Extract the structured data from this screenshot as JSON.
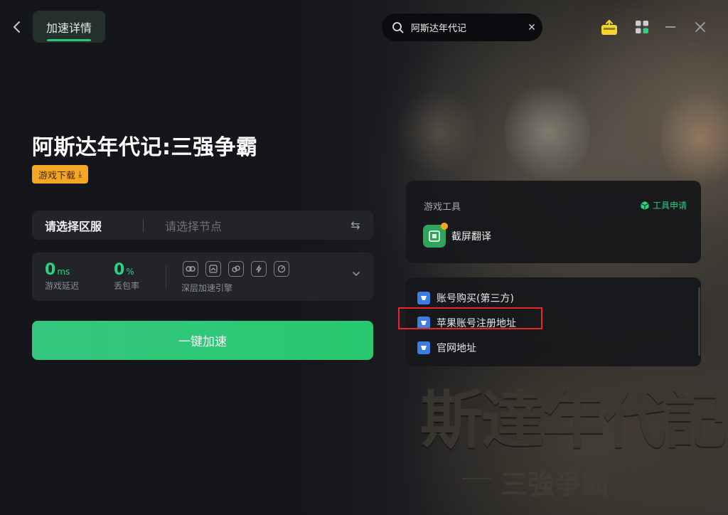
{
  "header": {
    "tab_label": "加速详情",
    "search_value": "阿斯达年代记",
    "icons": [
      "back-arrow-icon",
      "search-icon",
      "clear-icon",
      "gift-upload-icon",
      "apps-grid-icon",
      "minimize-icon",
      "close-icon"
    ]
  },
  "game": {
    "title": "阿斯达年代记:三强争霸",
    "download_label": "游戏下载"
  },
  "region": {
    "server_label": "请选择区服",
    "node_placeholder": "请选择节点"
  },
  "stats": {
    "latency_value": "0",
    "latency_unit": "ms",
    "latency_label": "游戏延迟",
    "loss_value": "0",
    "loss_unit": "%",
    "loss_label": "丢包率",
    "engine_label": "深层加速引擎"
  },
  "boost_button": "一键加速",
  "tools": {
    "title": "游戏工具",
    "apply_label": "工具申请",
    "items": [
      {
        "label": "截屏翻译",
        "icon": "screenshot-translate-icon"
      }
    ]
  },
  "links": [
    {
      "label": "账号购买(第三方)"
    },
    {
      "label": "苹果账号注册地址",
      "highlighted": true
    },
    {
      "label": "官网地址"
    }
  ],
  "colors": {
    "accent_green": "#2bd280",
    "badge_orange": "#f5a623",
    "highlight_red": "#e5262b",
    "link_icon_blue": "#3b7de0"
  },
  "background_art": {
    "title": "斯達年代記",
    "subtitle": "三強爭霸"
  }
}
